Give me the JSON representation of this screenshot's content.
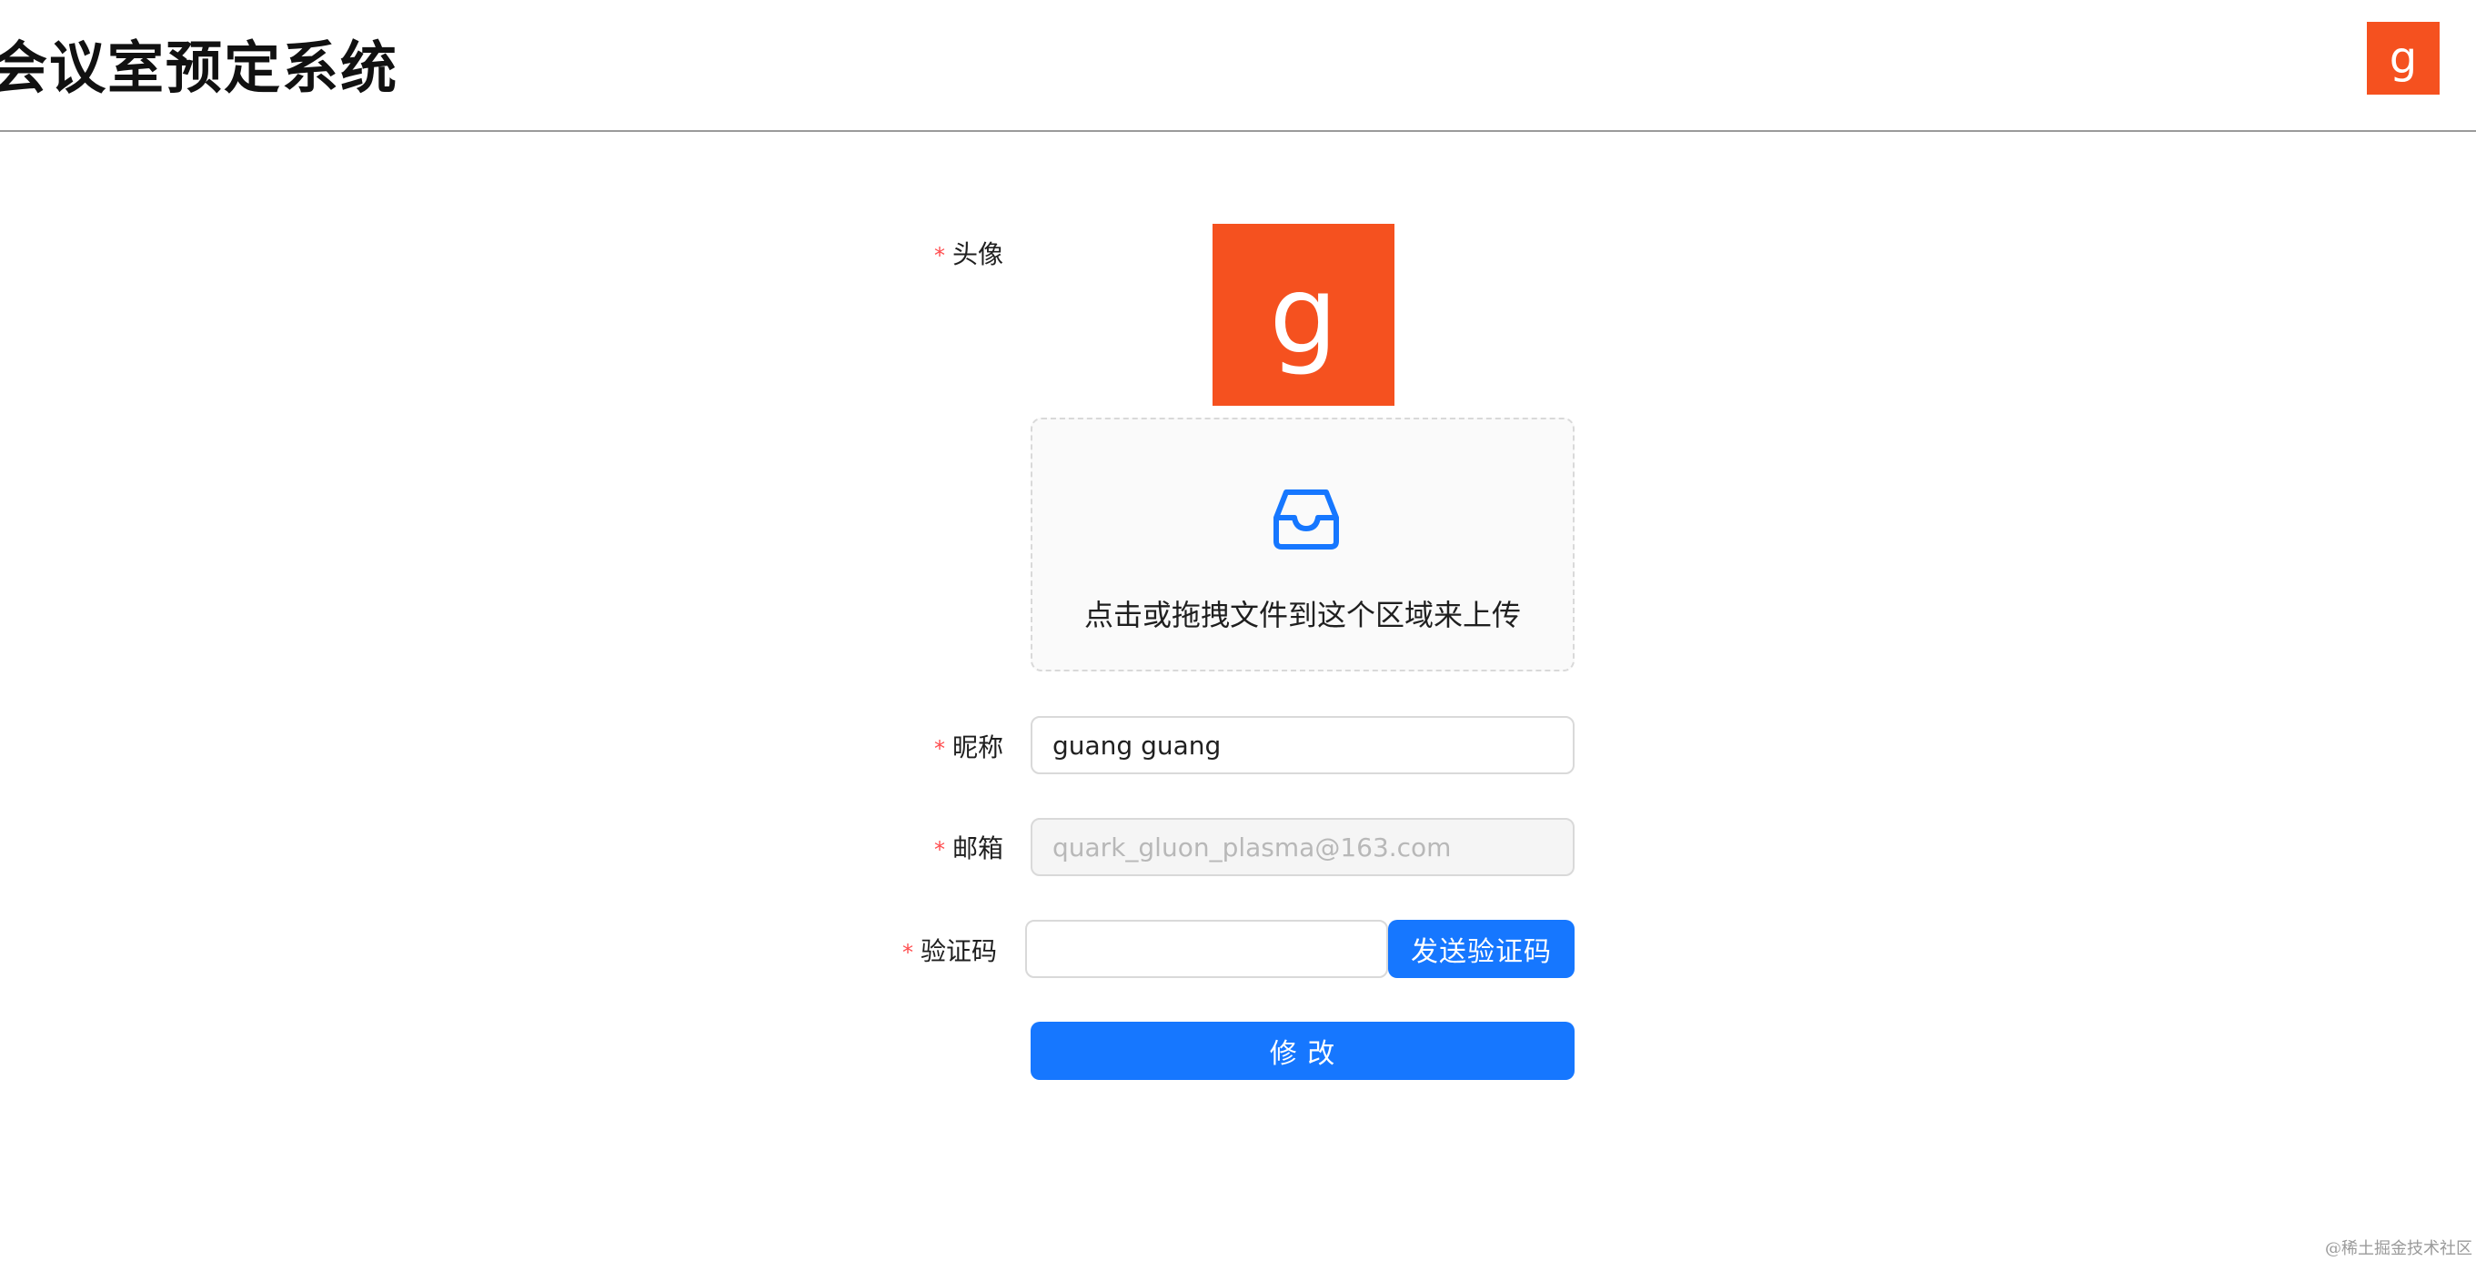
{
  "header": {
    "app_title": "会议室预定系统",
    "avatar_letter": "g",
    "avatar_color": "#f5511f"
  },
  "form": {
    "avatar": {
      "label": "头像",
      "required_mark": "*",
      "preview_letter": "g",
      "dropzone_icon": "inbox-icon",
      "dropzone_text": "点击或拖拽文件到这个区域来上传"
    },
    "nickname": {
      "label": "昵称",
      "required_mark": "*",
      "value": "guang guang"
    },
    "email": {
      "label": "邮箱",
      "required_mark": "*",
      "value": "quark_gluon_plasma@163.com",
      "disabled": true
    },
    "captcha": {
      "label": "验证码",
      "required_mark": "*",
      "value": "",
      "send_button_label": "发送验证码"
    },
    "submit_label": "修 改"
  },
  "colors": {
    "primary": "#1677ff",
    "avatar_bg": "#f5511f",
    "required": "#ff4d4f"
  },
  "watermark": "@稀土掘金技术社区"
}
